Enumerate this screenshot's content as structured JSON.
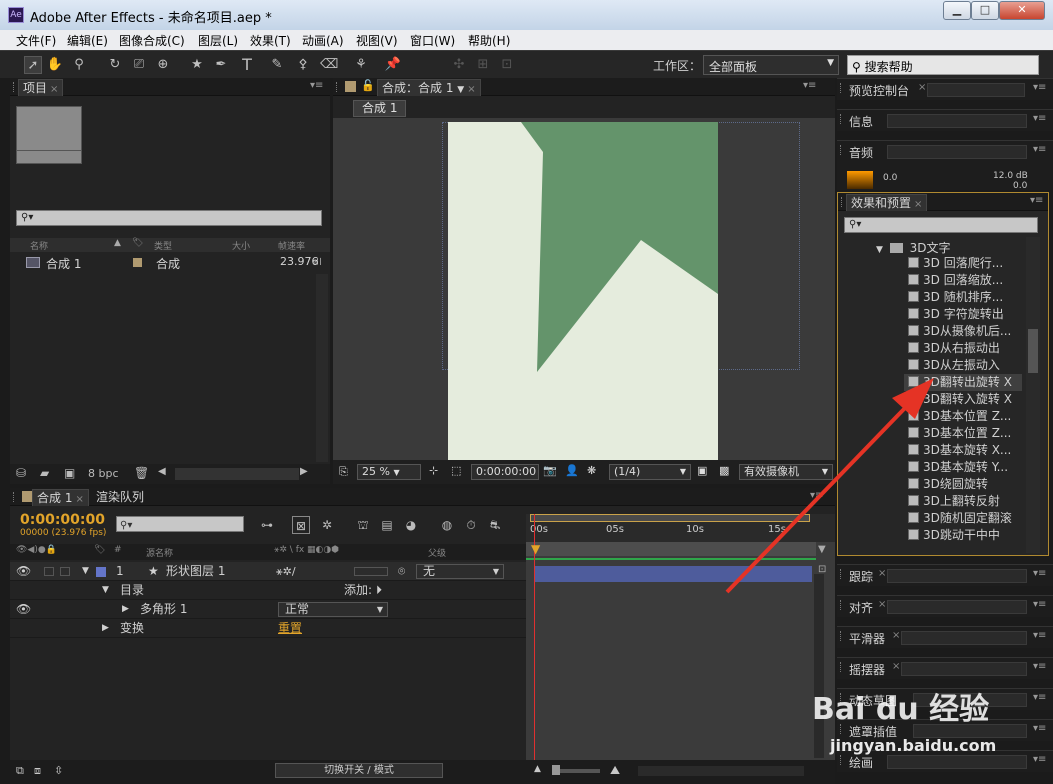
{
  "window": {
    "title": "Adobe After Effects - 未命名项目.aep *",
    "app_icon": "Ae",
    "min": "▁",
    "max": "□",
    "close": "✕"
  },
  "menu": [
    "文件(F)",
    "编辑(E)",
    "图像合成(C)",
    "图层(L)",
    "效果(T)",
    "动画(A)",
    "视图(V)",
    "窗口(W)",
    "帮助(H)"
  ],
  "toolbar": {
    "workspace_label": "工作区：",
    "workspace_value": "全部面板",
    "help_search": "搜索帮助"
  },
  "project": {
    "tab": "项目",
    "columns": [
      "名称",
      "类型",
      "大小",
      "帧速率"
    ],
    "row": {
      "name": "合成 1",
      "type": "合成",
      "fps": "23.976"
    },
    "bpc": "8 bpc"
  },
  "comp": {
    "tab": "合成：合成 1",
    "subtab": "合成 1",
    "zoom": "25 %",
    "timecode": "0:00:00:00",
    "resolution": "(1/4)",
    "camera": "有效摄像机"
  },
  "right": {
    "preview": "预览控制台",
    "info": "信息",
    "audio": "音频",
    "audio_left": "0.0",
    "audio_right": "12.0 dB",
    "audio_right2": "0.0",
    "effects": "效果和预置",
    "folder": "3D文字",
    "effects_list": [
      "3D 回落爬行...",
      "3D 回落缩放...",
      "3D 随机排序...",
      "3D 字符旋转出",
      "3D从摄像机后...",
      "3D从右振动出",
      "3D从左振动入",
      "3D翻转出旋转 X",
      "3D翻转入旋转 X",
      "3D基本位置 Z...",
      "3D基本位置 Z...",
      "3D基本旋转 X...",
      "3D基本旋转 Y...",
      "3D绕圆旋转",
      "3D上翻转反射",
      "3D随机固定翻滚",
      "3D跳动干中中"
    ],
    "selected_effect": 7,
    "tracker": "跟踪",
    "align": "对齐",
    "smoother": "平滑器",
    "wiggler": "摇摆器",
    "motion_sketch": "动态草图",
    "mask_interp": "遮罩插值",
    "paint": "绘画"
  },
  "timeline": {
    "tab": "合成 1",
    "render_tab": "渲染队列",
    "time": "0:00:00:00",
    "fps": "00000 (23.976 fps)",
    "col_source": "源名称",
    "col_parent": "父级",
    "layer_num": "1",
    "layer_name": "形状图层 1",
    "layer_parent": "无",
    "row_contents": "目录",
    "add_label": "添加:",
    "polygon": "多角形 1",
    "blend_mode": "正常",
    "transform": "变换",
    "reset": "重置",
    "ruler": [
      "00s",
      "05s",
      "10s",
      "15s"
    ],
    "switch_mode": "切换开关 / 模式"
  },
  "colors": {
    "accent": "#e2a42a",
    "shape": "#64946b",
    "canvas": "#e5ecdd",
    "layerbar": "#4e5c9c",
    "arrow": "#e53325"
  },
  "watermark": {
    "brand": "Bai du 经验",
    "url": "jingyan.baidu.com"
  }
}
